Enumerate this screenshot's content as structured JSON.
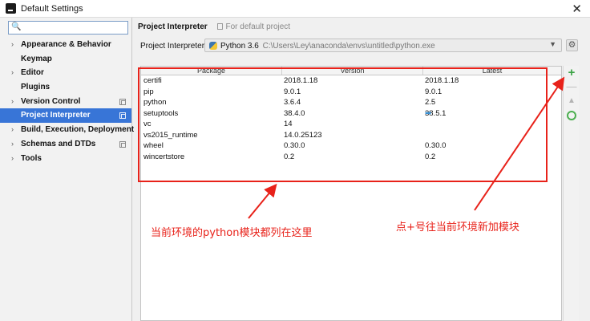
{
  "window": {
    "title": "Default Settings",
    "close_label": "✕"
  },
  "search": {
    "icon": "search-icon",
    "value": "",
    "placeholder": ""
  },
  "sidebar": {
    "items": [
      {
        "label": "Appearance & Behavior",
        "arrow": "›",
        "has_copy_icon": false
      },
      {
        "label": "Keymap",
        "arrow": "",
        "has_copy_icon": false
      },
      {
        "label": "Editor",
        "arrow": "›",
        "has_copy_icon": false
      },
      {
        "label": "Plugins",
        "arrow": "",
        "has_copy_icon": false
      },
      {
        "label": "Version Control",
        "arrow": "›",
        "has_copy_icon": true
      },
      {
        "label": "Project Interpreter",
        "arrow": "",
        "has_copy_icon": true,
        "selected": true
      },
      {
        "label": "Build, Execution, Deployment",
        "arrow": "›",
        "has_copy_icon": false
      },
      {
        "label": "Schemas and DTDs",
        "arrow": "›",
        "has_copy_icon": true
      },
      {
        "label": "Tools",
        "arrow": "›",
        "has_copy_icon": false
      }
    ]
  },
  "breadcrumb": {
    "title": "Project Interpreter",
    "subtitle": "For default project"
  },
  "interpreter": {
    "label": "Project Interpreter:",
    "value": "Python 3.6",
    "path": "C:\\Users\\Ley\\anaconda\\envs\\untitled\\python.exe",
    "dropdown_glyph": "▼",
    "gear_glyph": "⚙"
  },
  "packages": {
    "headers": {
      "package": "Package",
      "version": "Version",
      "latest": "Latest"
    },
    "rows": [
      {
        "package": "certifi",
        "version": "2018.1.18",
        "latest": "2018.1.18",
        "upgrade": false
      },
      {
        "package": "pip",
        "version": "9.0.1",
        "latest": "9.0.1",
        "upgrade": false
      },
      {
        "package": "python",
        "version": "3.6.4",
        "latest": "2.5",
        "upgrade": false
      },
      {
        "package": "setuptools",
        "version": "38.4.0",
        "latest": "38.5.1",
        "upgrade": true
      },
      {
        "package": "vc",
        "version": "14",
        "latest": "",
        "upgrade": false
      },
      {
        "package": "vs2015_runtime",
        "version": "14.0.25123",
        "latest": "",
        "upgrade": false
      },
      {
        "package": "wheel",
        "version": "0.30.0",
        "latest": "0.30.0",
        "upgrade": false
      },
      {
        "package": "wincertstore",
        "version": "0.2",
        "latest": "0.2",
        "upgrade": false
      }
    ]
  },
  "toolbar": {
    "add": "+",
    "remove": "—",
    "up": "▲"
  },
  "annotations": {
    "left_text": "当前环境的python模块都列在这里",
    "right_text": "点+号往当前环境新加模块",
    "color": "#e8221a"
  },
  "colors": {
    "selection": "#3875d7",
    "add_green": "#3aa244",
    "upgrade_blue": "#3a8fd1"
  }
}
